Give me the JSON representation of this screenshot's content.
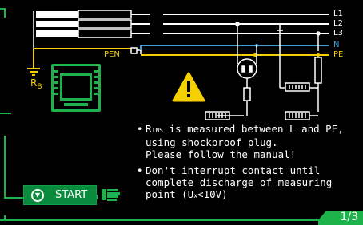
{
  "lines": {
    "l1": "L1",
    "l2": "L2",
    "l3": "L3",
    "n": "N",
    "pe": "PE",
    "pen": "PEN"
  },
  "rb": {
    "main": "R",
    "sub": "B"
  },
  "instructions": {
    "bullet": "•",
    "b1_prefix": "R",
    "b1_sub": "INS",
    "b1_l1_rest": " is measured between L and PE,",
    "b1_l2": "using shockproof plug.",
    "b1_l3": "Please follow the manual!",
    "b2_l1": "Don't interrupt contact until",
    "b2_l2": "complete discharge of measuring",
    "b2_l3_a": "point (U",
    "b2_l3_sub": "x",
    "b2_l3_b": "<10V)"
  },
  "start_button": {
    "label": "START",
    "icon": "chevron-down-circle-icon"
  },
  "page_indicator": "1/3",
  "colors": {
    "green": "#1db34a",
    "yellow": "#f5d000",
    "blue": "#3aa0e0",
    "white": "#ffffff"
  }
}
